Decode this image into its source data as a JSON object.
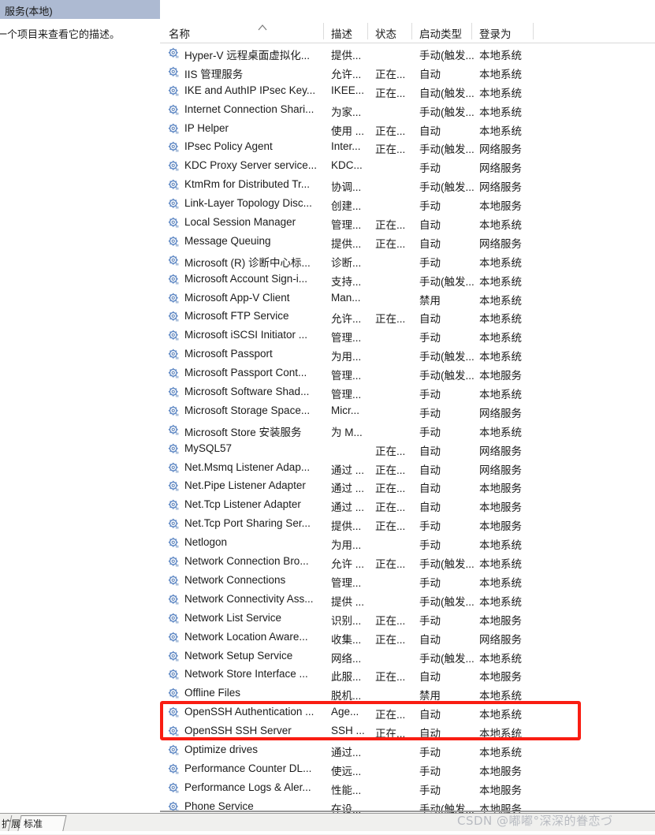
{
  "window": {
    "left_pane_title": "服务(本地)",
    "left_pane_description": "一个项目来查看它的描述。"
  },
  "columns": {
    "name": "名称",
    "description": "描述",
    "status": "状态",
    "startup_type": "启动类型",
    "log_on_as": "登录为",
    "sort_indicator": "ascending-caret"
  },
  "highlight": {
    "color": "#f91d12",
    "rows": [
      "OpenSSH Authentication ...",
      "OpenSSH SSH Server"
    ]
  },
  "footer": {
    "tab_extended": "扩展",
    "tab_standard": "标准",
    "watermark": "CSDN @嘟嘟°深深的眷恋づ"
  },
  "rows": [
    {
      "name": "Hyper-V 远程桌面虚拟化...",
      "desc": "提供...",
      "status": "",
      "startup": "手动(触发...",
      "logon": "本地系统"
    },
    {
      "name": "IIS 管理服务",
      "desc": "允许...",
      "status": "正在...",
      "startup": "自动",
      "logon": "本地系统"
    },
    {
      "name": "IKE and AuthIP IPsec Key...",
      "desc": "IKEE...",
      "status": "正在...",
      "startup": "自动(触发...",
      "logon": "本地系统"
    },
    {
      "name": "Internet Connection Shari...",
      "desc": "为家...",
      "status": "",
      "startup": "手动(触发...",
      "logon": "本地系统"
    },
    {
      "name": "IP Helper",
      "desc": "使用 ...",
      "status": "正在...",
      "startup": "自动",
      "logon": "本地系统"
    },
    {
      "name": "IPsec Policy Agent",
      "desc": "Inter...",
      "status": "正在...",
      "startup": "手动(触发...",
      "logon": "网络服务"
    },
    {
      "name": "KDC Proxy Server service...",
      "desc": "KDC...",
      "status": "",
      "startup": "手动",
      "logon": "网络服务"
    },
    {
      "name": "KtmRm for Distributed Tr...",
      "desc": "协调...",
      "status": "",
      "startup": "手动(触发...",
      "logon": "网络服务"
    },
    {
      "name": "Link-Layer Topology Disc...",
      "desc": "创建...",
      "status": "",
      "startup": "手动",
      "logon": "本地服务"
    },
    {
      "name": "Local Session Manager",
      "desc": "管理...",
      "status": "正在...",
      "startup": "自动",
      "logon": "本地系统"
    },
    {
      "name": "Message Queuing",
      "desc": "提供...",
      "status": "正在...",
      "startup": "自动",
      "logon": "网络服务"
    },
    {
      "name": "Microsoft (R) 诊断中心标...",
      "desc": "诊断...",
      "status": "",
      "startup": "手动",
      "logon": "本地系统"
    },
    {
      "name": "Microsoft Account Sign-i...",
      "desc": "支持...",
      "status": "",
      "startup": "手动(触发...",
      "logon": "本地系统"
    },
    {
      "name": "Microsoft App-V Client",
      "desc": "Man...",
      "status": "",
      "startup": "禁用",
      "logon": "本地系统"
    },
    {
      "name": "Microsoft FTP Service",
      "desc": "允许...",
      "status": "正在...",
      "startup": "自动",
      "logon": "本地系统"
    },
    {
      "name": "Microsoft iSCSI Initiator ...",
      "desc": "管理...",
      "status": "",
      "startup": "手动",
      "logon": "本地系统"
    },
    {
      "name": "Microsoft Passport",
      "desc": "为用...",
      "status": "",
      "startup": "手动(触发...",
      "logon": "本地系统"
    },
    {
      "name": "Microsoft Passport Cont...",
      "desc": "管理...",
      "status": "",
      "startup": "手动(触发...",
      "logon": "本地服务"
    },
    {
      "name": "Microsoft Software Shad...",
      "desc": "管理...",
      "status": "",
      "startup": "手动",
      "logon": "本地系统"
    },
    {
      "name": "Microsoft Storage Space...",
      "desc": "Micr...",
      "status": "",
      "startup": "手动",
      "logon": "网络服务"
    },
    {
      "name": "Microsoft Store 安装服务",
      "desc": "为 M...",
      "status": "",
      "startup": "手动",
      "logon": "本地系统"
    },
    {
      "name": "MySQL57",
      "desc": "",
      "status": "正在...",
      "startup": "自动",
      "logon": "网络服务"
    },
    {
      "name": "Net.Msmq Listener Adap...",
      "desc": "通过 ...",
      "status": "正在...",
      "startup": "自动",
      "logon": "网络服务"
    },
    {
      "name": "Net.Pipe Listener Adapter",
      "desc": "通过 ...",
      "status": "正在...",
      "startup": "自动",
      "logon": "本地服务"
    },
    {
      "name": "Net.Tcp Listener Adapter",
      "desc": "通过 ...",
      "status": "正在...",
      "startup": "自动",
      "logon": "本地服务"
    },
    {
      "name": "Net.Tcp Port Sharing Ser...",
      "desc": "提供...",
      "status": "正在...",
      "startup": "手动",
      "logon": "本地服务"
    },
    {
      "name": "Netlogon",
      "desc": "为用...",
      "status": "",
      "startup": "手动",
      "logon": "本地系统"
    },
    {
      "name": "Network Connection Bro...",
      "desc": "允许 ...",
      "status": "正在...",
      "startup": "手动(触发...",
      "logon": "本地系统"
    },
    {
      "name": "Network Connections",
      "desc": "管理...",
      "status": "",
      "startup": "手动",
      "logon": "本地系统"
    },
    {
      "name": "Network Connectivity Ass...",
      "desc": "提供 ...",
      "status": "",
      "startup": "手动(触发...",
      "logon": "本地系统"
    },
    {
      "name": "Network List Service",
      "desc": "识别...",
      "status": "正在...",
      "startup": "手动",
      "logon": "本地服务"
    },
    {
      "name": "Network Location Aware...",
      "desc": "收集...",
      "status": "正在...",
      "startup": "自动",
      "logon": "网络服务"
    },
    {
      "name": "Network Setup Service",
      "desc": "网络...",
      "status": "",
      "startup": "手动(触发...",
      "logon": "本地系统"
    },
    {
      "name": "Network Store Interface ...",
      "desc": "此服...",
      "status": "正在...",
      "startup": "自动",
      "logon": "本地服务"
    },
    {
      "name": "Offline Files",
      "desc": "脱机...",
      "status": "",
      "startup": "禁用",
      "logon": "本地系统"
    },
    {
      "name": "OpenSSH Authentication ...",
      "desc": "Age...",
      "status": "正在...",
      "startup": "自动",
      "logon": "本地系统"
    },
    {
      "name": "OpenSSH SSH Server",
      "desc": "SSH ...",
      "status": "正在...",
      "startup": "自动",
      "logon": "本地系统"
    },
    {
      "name": "Optimize drives",
      "desc": "通过...",
      "status": "",
      "startup": "手动",
      "logon": "本地系统"
    },
    {
      "name": "Performance Counter DL...",
      "desc": "使远...",
      "status": "",
      "startup": "手动",
      "logon": "本地服务"
    },
    {
      "name": "Performance Logs & Aler...",
      "desc": "性能...",
      "status": "",
      "startup": "手动",
      "logon": "本地服务"
    },
    {
      "name": "Phone Service",
      "desc": "在设...",
      "status": "",
      "startup": "手动(触发...",
      "logon": "本地服务"
    }
  ]
}
